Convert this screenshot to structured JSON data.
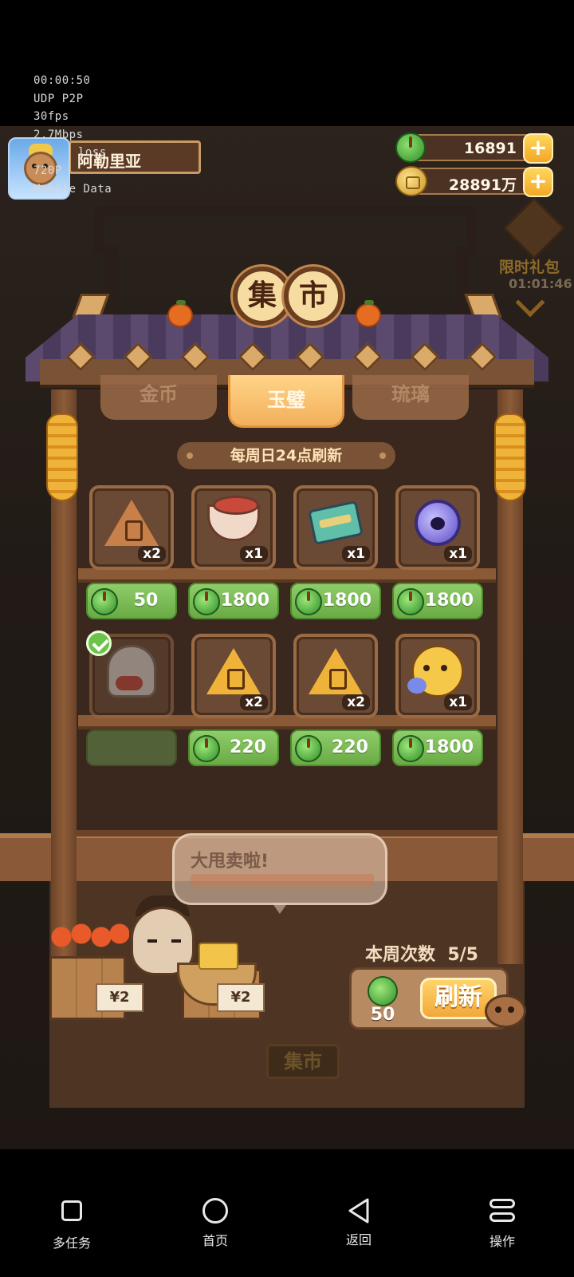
{
  "stream_stats": {
    "elapsed": "00:00:50",
    "protocol": "UDP P2P",
    "fps": "30fps",
    "bitrate": "2.7Mbps",
    "loss": "loss",
    "resolution": "720P",
    "network": "Mobile Data"
  },
  "player": {
    "name": "阿勒里亚"
  },
  "resources": {
    "jade": "16891",
    "gold": "28891万",
    "plus_label": "+"
  },
  "limited_gift": {
    "label": "限时礼包",
    "timer": "01:01:46"
  },
  "market": {
    "sign_chars": [
      "集",
      "市"
    ],
    "tabs": [
      {
        "label": "金币",
        "active": false
      },
      {
        "label": "玉璧",
        "active": true
      },
      {
        "label": "琉璃",
        "active": false
      }
    ],
    "refresh_note": "每周日24点刷新",
    "items": [
      {
        "qty": "x2",
        "price": "50",
        "icon": "brown-triangle-token-icon",
        "sold": false
      },
      {
        "qty": "x1",
        "price": "1800",
        "icon": "porcelain-bowl-icon",
        "sold": false
      },
      {
        "qty": "x1",
        "price": "1800",
        "icon": "treasure-chest-icon",
        "sold": false
      },
      {
        "qty": "x1",
        "price": "1800",
        "icon": "purple-cat-orb-icon",
        "sold": false
      },
      {
        "qty": "",
        "price": "",
        "icon": "character-portrait-icon",
        "sold": true
      },
      {
        "qty": "x2",
        "price": "220",
        "icon": "gold-triangle-token-icon",
        "sold": false
      },
      {
        "qty": "x2",
        "price": "220",
        "icon": "gold-triangle-token-icon",
        "sold": false
      },
      {
        "qty": "x1",
        "price": "1800",
        "icon": "yellow-cat-pet-icon",
        "sold": false
      }
    ],
    "vendor_bubble_title": "大甩卖啦!",
    "price_tags": [
      "¥2",
      "¥2"
    ],
    "weekly_count_label": "本周次数",
    "weekly_count_value": "5/5",
    "refresh_cost": "50",
    "refresh_button": "刷新",
    "floor_sign": "集市"
  },
  "navigation": {
    "items": [
      {
        "label": "多任务",
        "icon": "square-icon"
      },
      {
        "label": "首页",
        "icon": "circle-icon"
      },
      {
        "label": "返回",
        "icon": "back-triangle-icon"
      },
      {
        "label": "操作",
        "icon": "operation-icon"
      }
    ]
  }
}
